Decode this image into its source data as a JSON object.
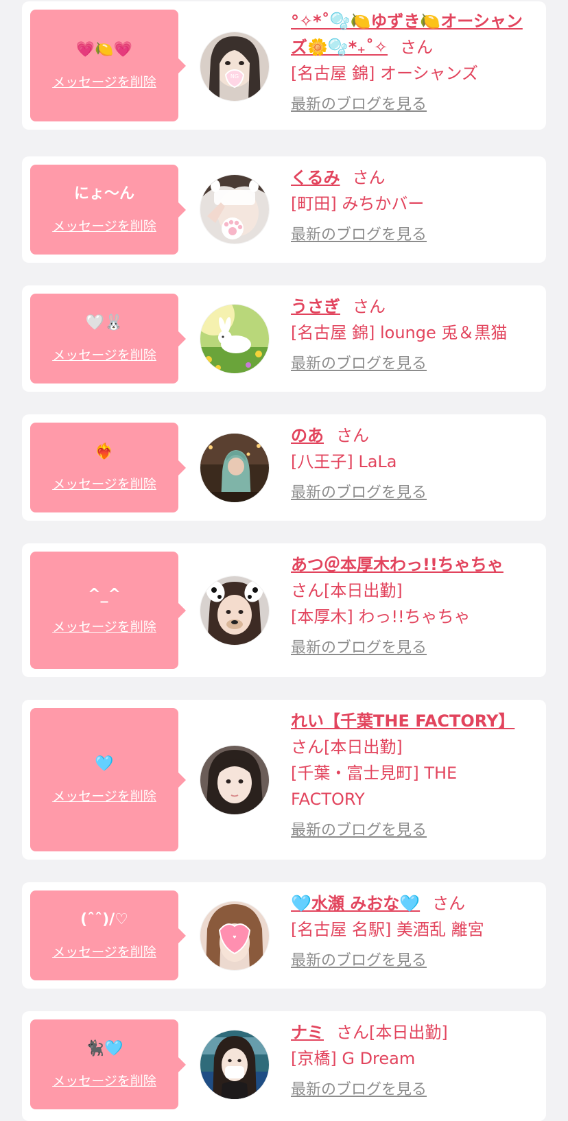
{
  "delete_label": "メッセージを削除",
  "blog_label": "最新のブログを見る",
  "colors": {
    "accent": "#e2445d",
    "bubble": "#ff9aa9",
    "background": "#f2f2f4",
    "muted": "#8c8c8c"
  },
  "messages": [
    {
      "message": "💗🍋💗",
      "name": "°✧*˚🫧🍋ゆずき🍋オーシャンズ🌼🫧*₊˚✧",
      "suffix": "さん",
      "shop": "[名古屋 錦] オーシャンズ",
      "avatar": "girl-heart-sticker-photo"
    },
    {
      "message": "にょ〜ん",
      "name": "くるみ",
      "suffix": "さん",
      "shop": "[町田] みちかバー",
      "avatar": "girl-paw-sticker-photo"
    },
    {
      "message": "🤍🐰",
      "name": "うさぎ",
      "suffix": "さん",
      "shop": "[名古屋 錦] lounge 兎＆黒猫",
      "avatar": "bunny-meadow-illustration"
    },
    {
      "message": "❤️‍🔥",
      "name": "のあ",
      "suffix": "さん",
      "shop": "[八王子] LaLa",
      "avatar": "girl-hood-night-photo"
    },
    {
      "message": "^_^",
      "name": "あつ＠本厚木わっ!!ちゃちゃ",
      "suffix": "さん[本日出勤]",
      "shop": "[本厚木] わっ!!ちゃちゃ",
      "avatar": "girl-dog-filter-photo"
    },
    {
      "message": "🩵",
      "name": "れい【千葉THE FACTORY】",
      "suffix": "さん[本日出勤]",
      "shop": "[千葉・富士見町] THE FACTORY",
      "avatar": "girl-portrait-photo"
    },
    {
      "message": "(ˆˆ)/♡",
      "name": "🩵水瀬 みおな🩵",
      "suffix": "さん",
      "shop": "[名古屋 名駅] 美酒乱 離宮",
      "avatar": "girl-heart-sticker-photo"
    },
    {
      "message": "🐈‍⬛🩵",
      "name": "ナミ",
      "suffix": "さん[本日出勤]",
      "shop": "[京橋] G Dream",
      "avatar": "girl-mask-train-photo"
    }
  ]
}
